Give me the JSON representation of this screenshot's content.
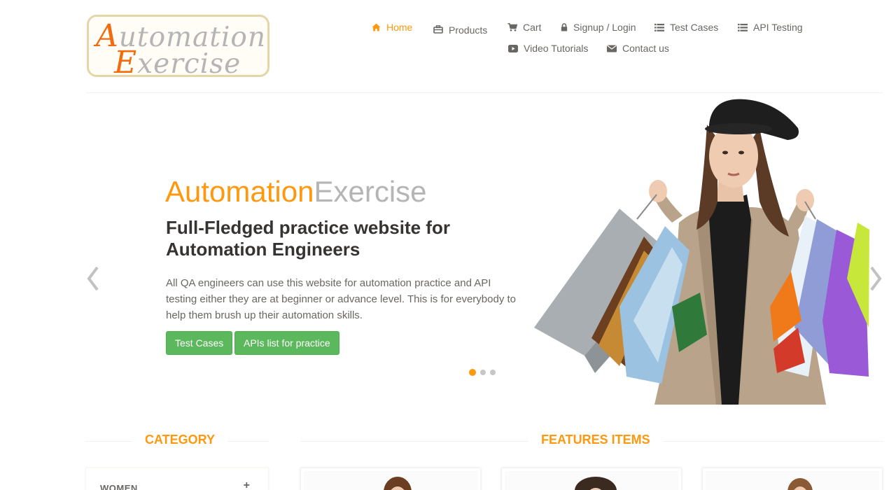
{
  "logo": {
    "line1_cap": "A",
    "line1_rest": "utomation",
    "line2_cap": "E",
    "line2_rest": "xercise"
  },
  "nav": {
    "items": [
      {
        "label": "Home",
        "icon": "home-icon",
        "active": true
      },
      {
        "label": "Products",
        "icon": "products-icon",
        "active": false
      },
      {
        "label": "Cart",
        "icon": "cart-icon",
        "active": false
      },
      {
        "label": "Signup / Login",
        "icon": "lock-icon",
        "active": false
      },
      {
        "label": "Test Cases",
        "icon": "list-icon",
        "active": false
      },
      {
        "label": "API Testing",
        "icon": "list-icon",
        "active": false
      },
      {
        "label": "Video Tutorials",
        "icon": "youtube-icon",
        "active": false
      },
      {
        "label": "Contact us",
        "icon": "envelope-icon",
        "active": false
      }
    ]
  },
  "slider": {
    "brand_part1": "Automation",
    "brand_part2": "Exercise",
    "heading": "Full-Fledged practice website for Automation Engineers",
    "text": "All QA engineers can use this website for automation practice and API testing either they are at beginner or advance level. This is for everybody to help them brush up their automation skills.",
    "button_test_cases": "Test Cases",
    "button_apis": "APIs list for practice",
    "slide_count": 3,
    "active_slide": 1
  },
  "category": {
    "title": "CATEGORY",
    "items": [
      {
        "label": "WOMEN",
        "toggle": "+"
      }
    ]
  },
  "features": {
    "title": "FEATURES ITEMS"
  },
  "colors": {
    "accent": "#fe980f",
    "logo_orange": "#f26b0d",
    "grey_text": "#696763",
    "button_green": "#5cb85c"
  }
}
